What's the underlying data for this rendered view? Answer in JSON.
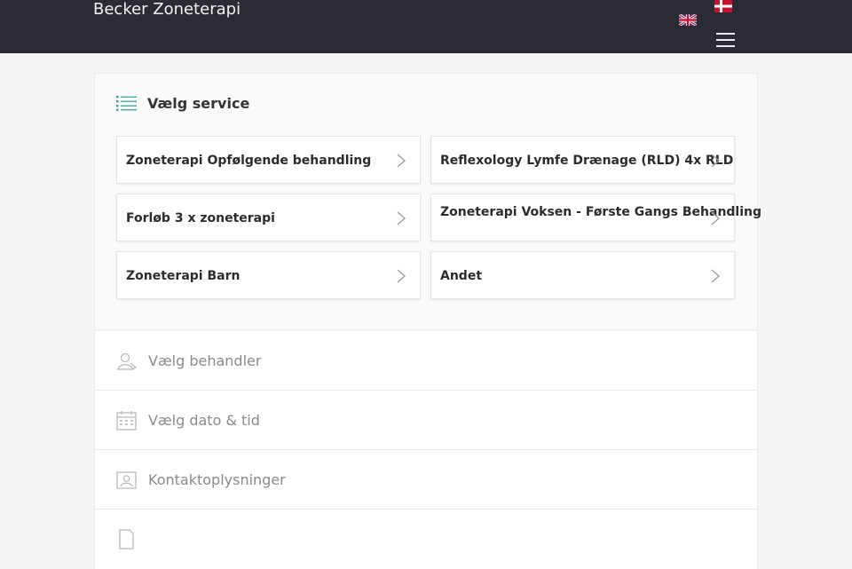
{
  "header": {
    "brand": "Becker Zoneterapi",
    "languages": [
      "English",
      "Dansk"
    ],
    "menu_icon": "hamburger-menu-icon"
  },
  "service_card": {
    "title": "Vælg service",
    "icon": "list-icon",
    "options": [
      "Zoneterapi Opfølgende behandling",
      "Reflexology Lymfe Drænage (RLD) 4x RLD",
      "Forløb 3 x zoneterapi",
      "Zoneterapi Voksen - Første Gangs Behandling",
      "Zoneterapi Barn",
      "Andet"
    ]
  },
  "steps": [
    {
      "label": "Vælg behandler",
      "icon": "person-icon"
    },
    {
      "label": "Vælg dato & tid",
      "icon": "calendar-icon"
    },
    {
      "label": "Kontaktoplysninger",
      "icon": "contact-card-icon"
    }
  ],
  "colors": {
    "header_bg": "#2a2b35",
    "accent": "#3aa5a0",
    "page_bg": "#f4f5f7"
  }
}
